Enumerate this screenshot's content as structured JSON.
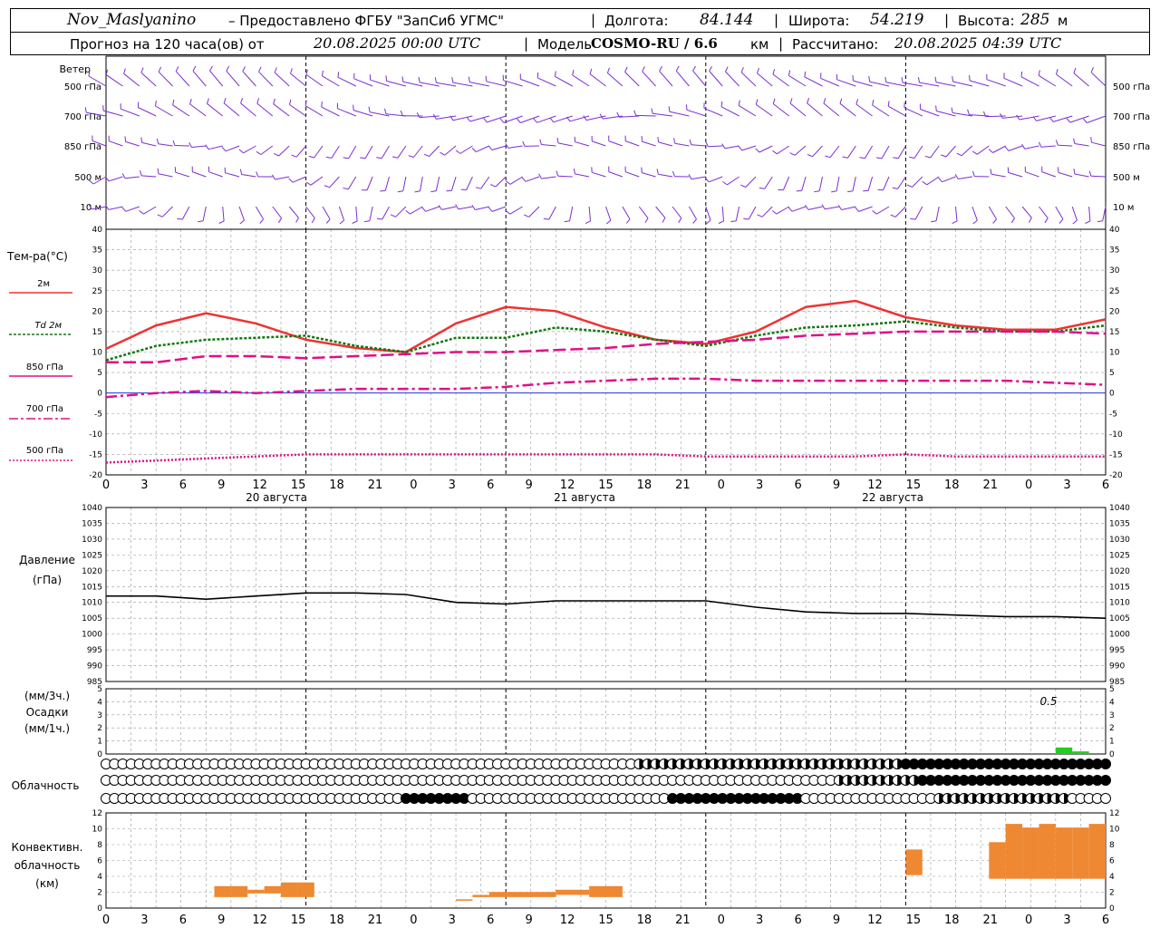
{
  "header": {
    "station": "Nov_Maslyanino",
    "provider": "– Предоставлено ФГБУ \"ЗапСиб УГМС\"",
    "lon_label": "Долгота:",
    "lon_value": "84.144",
    "lat_label": "Широта:",
    "lat_value": "54.219",
    "alt_label": "Высота:",
    "alt_value": "285",
    "alt_unit": "м",
    "forecast_label": "Прогноз на 120 часа(ов) от",
    "forecast_time": "20.08.2025 00:00 UTC",
    "model_label": "Модель",
    "model_name": "COSMO-RU / 6.6",
    "model_unit": "км",
    "calc_label": "Рассчитано:",
    "calc_time": "20.08.2025 04:39 UTC"
  },
  "wind_panel": {
    "title": "Ветер",
    "levels": [
      "500 гПа",
      "700 гПа",
      "850 гПа",
      "500 м",
      "10 м"
    ],
    "barb_color": "#7b2fd0"
  },
  "temp_panel": {
    "title": "Тем-ра(°С)",
    "legend": [
      {
        "label": "2м",
        "color": "#ee3333",
        "style": "solid"
      },
      {
        "label": "Td  2м",
        "color": "#117711",
        "style": "dotted"
      },
      {
        "label": "850 гПа",
        "color": "#dd1188",
        "style": "dashed"
      },
      {
        "label": "700 гПа",
        "color": "#dd1188",
        "style": "dashdot"
      },
      {
        "label": "500 гПа",
        "color": "#dd1188",
        "style": "dotted"
      }
    ]
  },
  "time_axis": {
    "hour_labels": [
      "0",
      "3",
      "6",
      "9",
      "12",
      "15",
      "18",
      "21",
      "0",
      "3",
      "6",
      "9",
      "12",
      "15",
      "18",
      "21",
      "0",
      "3",
      "6",
      "9",
      "12",
      "15",
      "18",
      "21",
      "0",
      "3",
      "6"
    ],
    "day_labels": [
      "20 августа",
      "21 августа",
      "22 августа"
    ]
  },
  "pressure_panel": {
    "title": "Давление",
    "unit": "(гПа)"
  },
  "precip_panel": {
    "label_3h": "(мм/3ч.)",
    "title": "Осадки",
    "label_1h": "(мм/1ч.)",
    "max_label": "0.5",
    "bar_color": "#22cc22"
  },
  "cloud_panel": {
    "title": "Облачность",
    "rows": [
      "0000000000000000000000000000000000000000000000000000000000000000000000000000000000000000000000000000000000000000000000000",
      "0000000000000000000000000000000000000000000000000000000000000000000000000000000000000000000000000000000000000000000000000",
      "0000000000000000000000000000000000000000000000000000000000000000000000000000000000000000000000000000000000000000000000000"
    ]
  },
  "conv_panel": {
    "title1": "Конвективн.",
    "title2": "облачность",
    "unit": "(км)",
    "bar_color": "#ee8833"
  },
  "chart_data": [
    {
      "type": "line",
      "title": "Тем-ра(°С)",
      "xlabel": "",
      "ylabel": "Тем-ра(°С)",
      "ylim": [
        -20,
        40
      ],
      "x_hours": [
        0,
        6,
        12,
        18,
        24,
        30,
        36,
        42,
        48,
        54,
        60,
        66,
        72,
        78,
        84,
        90,
        96,
        102,
        108,
        114,
        120
      ],
      "series": [
        {
          "name": "2м",
          "values": [
            10.8,
            16.5,
            19.5,
            17,
            13,
            11,
            10,
            17,
            21,
            20,
            16,
            13,
            12,
            15,
            21,
            22.5,
            18.5,
            16.5,
            15.5,
            15.5,
            18
          ]
        },
        {
          "name": "Td  2м",
          "values": [
            8,
            11.5,
            13,
            13.5,
            14,
            11.5,
            10,
            13.5,
            13.5,
            16,
            15,
            13,
            11.5,
            14,
            16,
            16.5,
            17.5,
            16,
            15,
            15,
            16.5
          ]
        },
        {
          "name": "850 гПа",
          "values": [
            7.5,
            7.5,
            9,
            9,
            8.5,
            9,
            9.5,
            10,
            10,
            10.5,
            11,
            12,
            12.5,
            13,
            14,
            14.5,
            15,
            15,
            15,
            15,
            14.5
          ]
        },
        {
          "name": "700 гПа",
          "values": [
            -1,
            0,
            0.5,
            0,
            0.5,
            1,
            1,
            1,
            1.5,
            2.5,
            3,
            3.5,
            3.5,
            3,
            3,
            3,
            3,
            3,
            3,
            2.5,
            2
          ]
        },
        {
          "name": "500 гПа",
          "values": [
            -17,
            -16.5,
            -16,
            -15.5,
            -15,
            -15,
            -15,
            -15,
            -15,
            -15,
            -15,
            -15,
            -15.5,
            -15.5,
            -15.5,
            -15.5,
            -15,
            -15.5,
            -15.5,
            -15.5,
            -15.5
          ]
        }
      ]
    },
    {
      "type": "line",
      "title": "Давление",
      "ylabel": "(гПа)",
      "ylim": [
        985,
        1040
      ],
      "x_hours": [
        0,
        6,
        12,
        18,
        24,
        30,
        36,
        42,
        48,
        54,
        60,
        66,
        72,
        78,
        84,
        90,
        96,
        102,
        108,
        114,
        120
      ],
      "series": [
        {
          "name": "Давление",
          "values": [
            1012,
            1012,
            1011,
            1012,
            1013,
            1013,
            1012.5,
            1010,
            1009.5,
            1010.5,
            1010.5,
            1010.5,
            1010.5,
            1008.5,
            1007,
            1006.5,
            1006.5,
            1006,
            1005.5,
            1005.5,
            1005
          ]
        }
      ]
    },
    {
      "type": "bar",
      "title": "Осадки",
      "ylabel": "(мм/1ч.)",
      "ylim": [
        0,
        5
      ],
      "x_hours": [
        114,
        115,
        116,
        117
      ],
      "values": [
        0.5,
        0.5,
        0.2,
        0.2
      ]
    },
    {
      "type": "bar",
      "title": "Конвективн. облачность",
      "ylabel": "(км)",
      "ylim": [
        0,
        13
      ],
      "bars": [
        {
          "start": 13,
          "end": 15,
          "base": 1.5,
          "top": 3
        },
        {
          "start": 15,
          "end": 17,
          "base": 1.5,
          "top": 3
        },
        {
          "start": 17,
          "end": 19,
          "base": 2,
          "top": 2.5
        },
        {
          "start": 19,
          "end": 21,
          "base": 2,
          "top": 3
        },
        {
          "start": 21,
          "end": 23,
          "base": 1.5,
          "top": 3.5
        },
        {
          "start": 23,
          "end": 25,
          "base": 1.5,
          "top": 3.5
        },
        {
          "start": 42,
          "end": 44,
          "base": 1,
          "top": 1.2
        },
        {
          "start": 44,
          "end": 46,
          "base": 1.5,
          "top": 1.8
        },
        {
          "start": 46,
          "end": 54,
          "base": 1.5,
          "top": 2.2
        },
        {
          "start": 54,
          "end": 58,
          "base": 1.8,
          "top": 2.5
        },
        {
          "start": 58,
          "end": 60,
          "base": 1.5,
          "top": 3
        },
        {
          "start": 60,
          "end": 62,
          "base": 1.5,
          "top": 3
        },
        {
          "start": 96,
          "end": 98,
          "base": 4.5,
          "top": 8
        },
        {
          "start": 106,
          "end": 108,
          "base": 4,
          "top": 9
        },
        {
          "start": 108,
          "end": 110,
          "base": 4,
          "top": 11.5
        },
        {
          "start": 110,
          "end": 112,
          "base": 4,
          "top": 11
        },
        {
          "start": 112,
          "end": 114,
          "base": 4,
          "top": 11.5
        },
        {
          "start": 114,
          "end": 116,
          "base": 4,
          "top": 11
        },
        {
          "start": 116,
          "end": 118,
          "base": 4,
          "top": 11
        },
        {
          "start": 118,
          "end": 120,
          "base": 4,
          "top": 11.5
        }
      ]
    }
  ]
}
